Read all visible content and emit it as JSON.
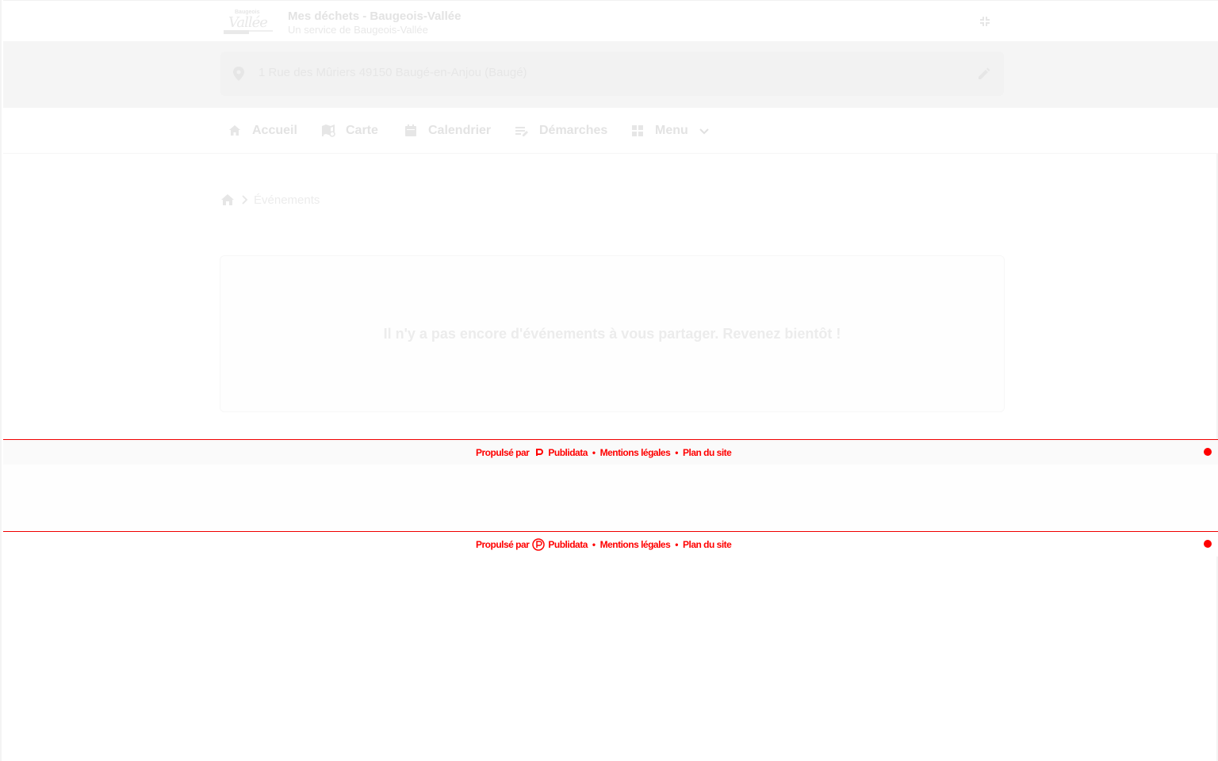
{
  "header": {
    "logo": {
      "text": "Baugeois",
      "script": "Vallée"
    },
    "title": "Mes déchets - Baugeois-Vallée",
    "subtitle": "Un service de Baugeois-Vallée"
  },
  "address": {
    "value": "1 Rue des Mûriers 49150 Baugé-en-Anjou (Baugé)"
  },
  "nav": {
    "items": [
      {
        "label": "Accueil",
        "icon": "home-icon"
      },
      {
        "label": "Carte",
        "icon": "map-icon"
      },
      {
        "label": "Calendrier",
        "icon": "calendar-icon"
      },
      {
        "label": "Démarches",
        "icon": "form-edit-icon"
      },
      {
        "label": "Menu",
        "icon": "grid-icon"
      }
    ]
  },
  "breadcrumb": {
    "current": "Événements"
  },
  "main": {
    "empty_message": "Il n'y a pas encore d'événements à vous partager. Revenez bientôt !"
  },
  "footer": {
    "powered_by": "Propulsé par",
    "brand": "Publidata",
    "legal": "Mentions légales",
    "sitemap": "Plan du site",
    "separator": "•"
  },
  "colors": {
    "footer_accent": "#ff0000",
    "faded_text": "#e3e3e3",
    "address_band": "#f5f5f5"
  }
}
